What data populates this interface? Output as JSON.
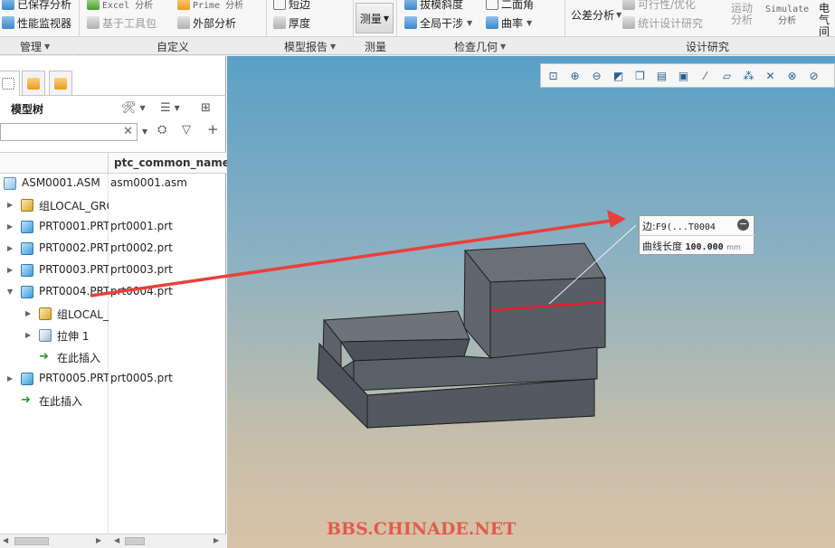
{
  "ribbon": {
    "col1": [
      {
        "name": "saved-analysis",
        "label": "已保存分析",
        "icon": "analysis-icon"
      },
      {
        "name": "perf-monitor",
        "label": "性能监视器",
        "icon": "monitor-icon"
      }
    ],
    "col2": [
      {
        "name": "excel-analysis",
        "label": "Excel 分析",
        "icon": "excel-icon"
      },
      {
        "name": "toolkit",
        "label": "基于工具包",
        "icon": "toolkit-icon"
      }
    ],
    "col3": [
      {
        "name": "prime-analysis",
        "label": "Prime 分析",
        "icon": "prime-icon"
      },
      {
        "name": "external-analysis",
        "label": "外部分析",
        "icon": "external-icon"
      }
    ],
    "col4": [
      {
        "name": "short-edge",
        "label": "短边",
        "icon": "short-edge-icon"
      },
      {
        "name": "thickness",
        "label": "厚度",
        "icon": "thickness-icon"
      }
    ],
    "measure": "测量",
    "col5": [
      {
        "name": "draft",
        "label": "拔模斜度",
        "icon": "draft-icon"
      },
      {
        "name": "global-interference",
        "label": "全局干涉",
        "icon": "interference-icon"
      }
    ],
    "col6": [
      {
        "name": "dihedral",
        "label": "二面角",
        "icon": "dihedral-icon"
      },
      {
        "name": "curvature",
        "label": "曲率",
        "icon": "curvature-icon"
      }
    ],
    "tolerance": "公差分析",
    "feasibility": "可行性/优化",
    "statistical": "统计设计研究",
    "motion": "运动\n分析",
    "simulate": "Simulate\n分析",
    "electrical": "电气\n间隙"
  },
  "groups": [
    {
      "name": "group-manage",
      "label": "管理"
    },
    {
      "name": "group-custom",
      "label": "自定义"
    },
    {
      "name": "group-model-report",
      "label": "模型报告"
    },
    {
      "name": "group-measure",
      "label": "测量"
    },
    {
      "name": "group-inspect-geometry",
      "label": "检查几何"
    },
    {
      "name": "group-design-study",
      "label": "设计研究"
    }
  ],
  "panel": {
    "title": "模型树",
    "search_placeholder": "",
    "column_header": "ptc_common_name",
    "rows": [
      {
        "name": "ASM0001.ASM",
        "common": "asm0001.asm",
        "icon": "assembly-icon"
      },
      {
        "name": "组LOCAL_GROUP",
        "common": "",
        "icon": "local-group-icon"
      },
      {
        "name": "PRT0001.PRT",
        "common": "prt0001.prt",
        "icon": "part-icon"
      },
      {
        "name": "PRT0002.PRT",
        "common": "prt0002.prt",
        "icon": "part-icon"
      },
      {
        "name": "PRT0003.PRT",
        "common": "prt0003.prt",
        "icon": "part-icon"
      },
      {
        "name": "PRT0004.PRT",
        "common": "prt0004.prt",
        "icon": "part-icon"
      },
      {
        "name": "组LOCAL_GROUP",
        "common": "",
        "icon": "local-group-icon"
      },
      {
        "name": "拉伸 1",
        "common": "",
        "icon": "extrude-icon"
      },
      {
        "name": "在此插入",
        "common": "",
        "icon": "insert-here-icon"
      },
      {
        "name": "PRT0005.PRT",
        "common": "prt0005.prt",
        "icon": "part-icon"
      },
      {
        "name": "在此插入",
        "common": "",
        "icon": "insert-here-icon"
      }
    ]
  },
  "tooltip": {
    "edge_label": "边:",
    "edge_ref": "F9(...T0004",
    "length_label": "曲线长度",
    "length_value": "100.000",
    "unit": "mm"
  },
  "watermark": "BBS.CHINADE.NET",
  "colors": {
    "arrow": "#e8403a",
    "measured_edge": "#e0202e",
    "model_face": "#575d66"
  }
}
